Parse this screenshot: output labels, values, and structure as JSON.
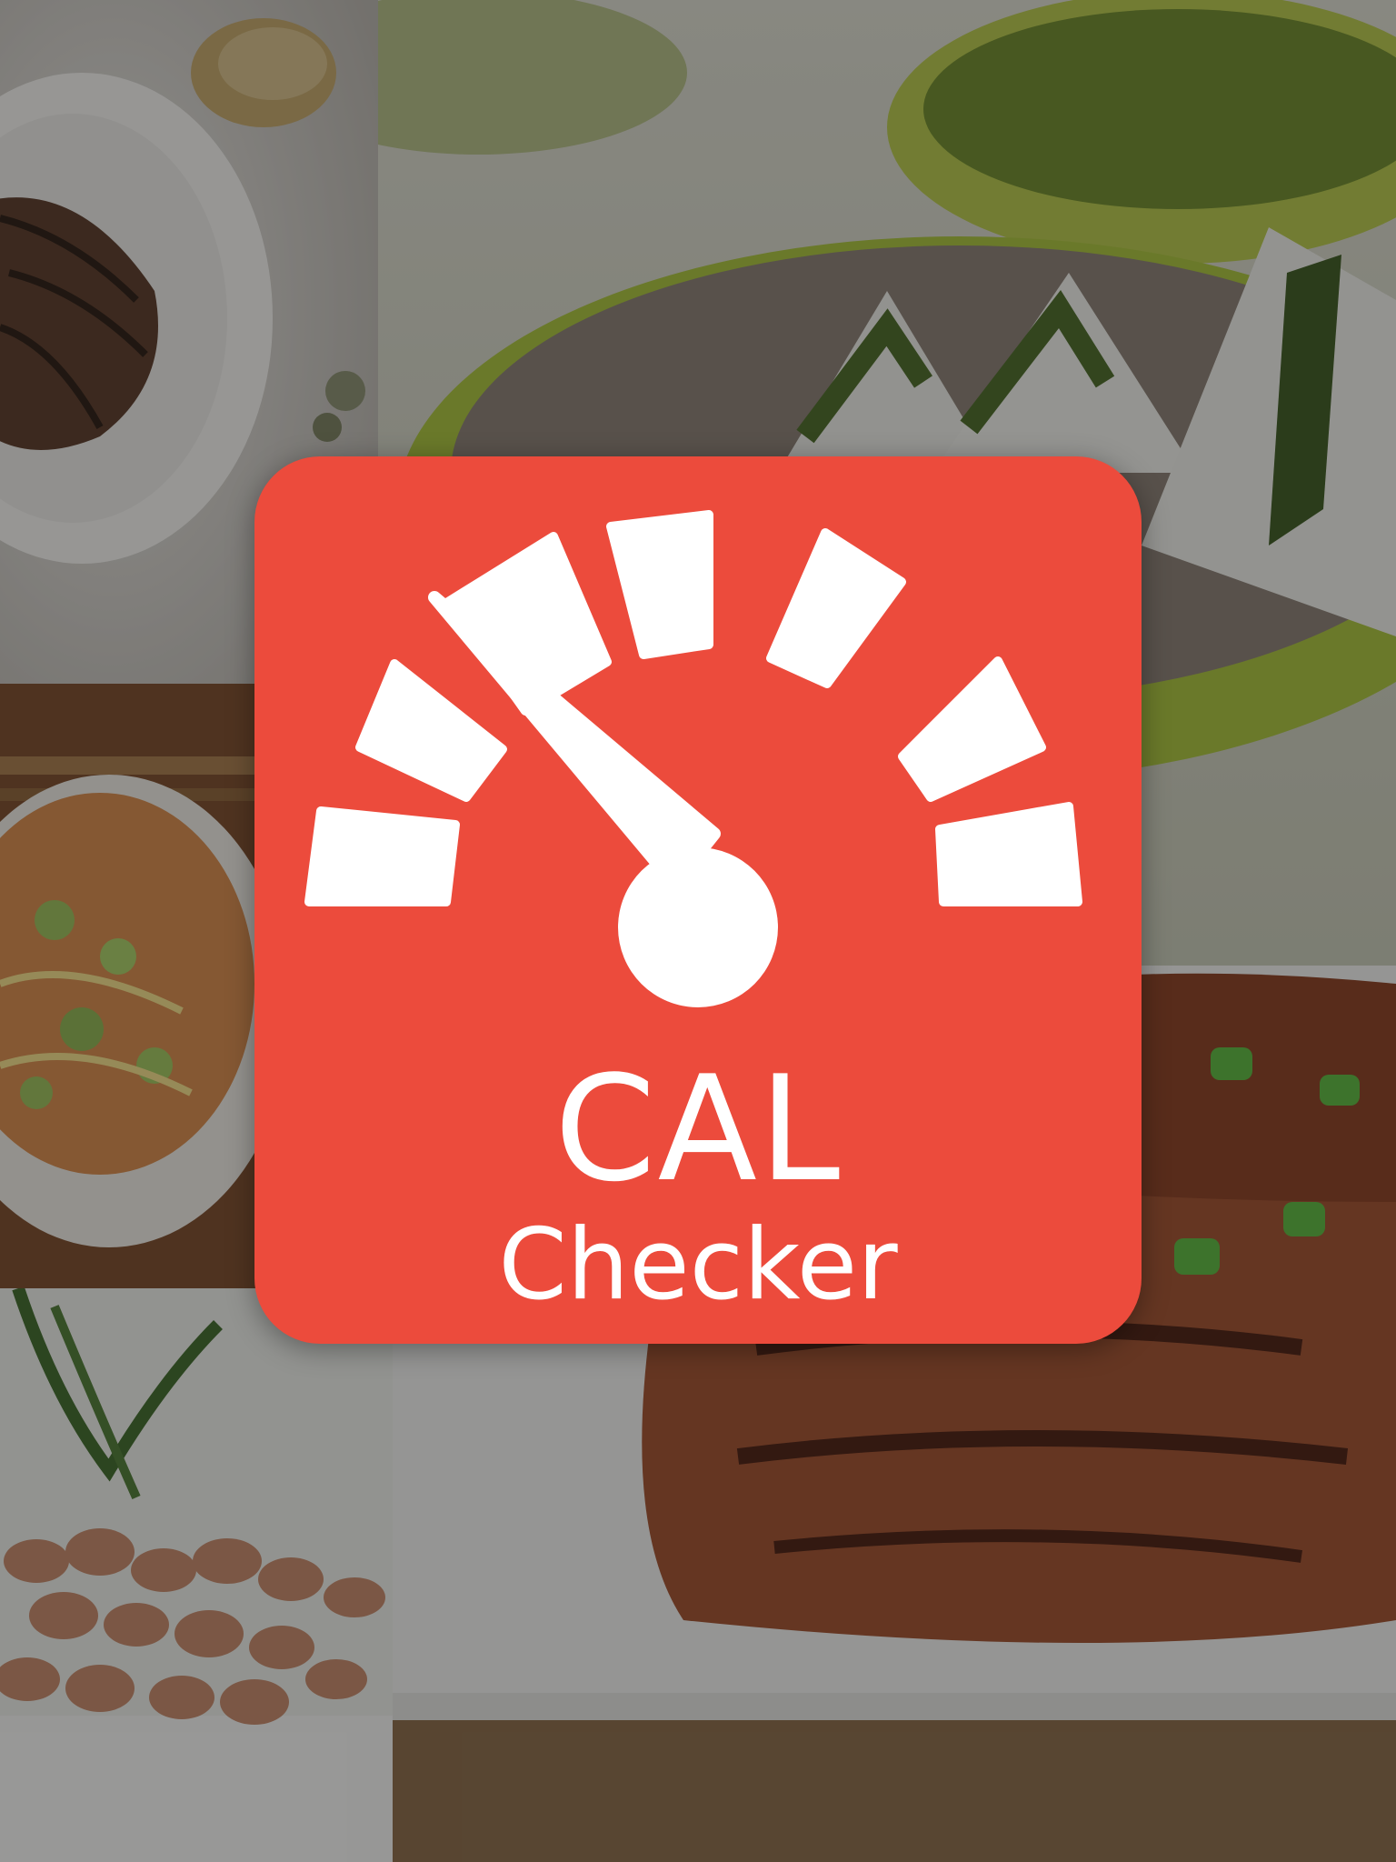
{
  "screen": {
    "background_color": "#2a2a2a",
    "overlay": "dark-dim"
  },
  "collage": {
    "tiles": [
      {
        "subject": "chocolate-crepe-dessert"
      },
      {
        "subject": "rice-ball-onigiri-bowl"
      },
      {
        "subject": "fried-rice-noodle-bowl"
      },
      {
        "subject": "peanuts-bowl"
      },
      {
        "subject": "grilled-chicken-with-scallions"
      }
    ]
  },
  "app_icon": {
    "background_color": "#ec4b3c",
    "foreground_color": "#ffffff",
    "icon": "speedometer-gauge-icon",
    "title_line1": "CAL",
    "title_line2": "Checker"
  }
}
